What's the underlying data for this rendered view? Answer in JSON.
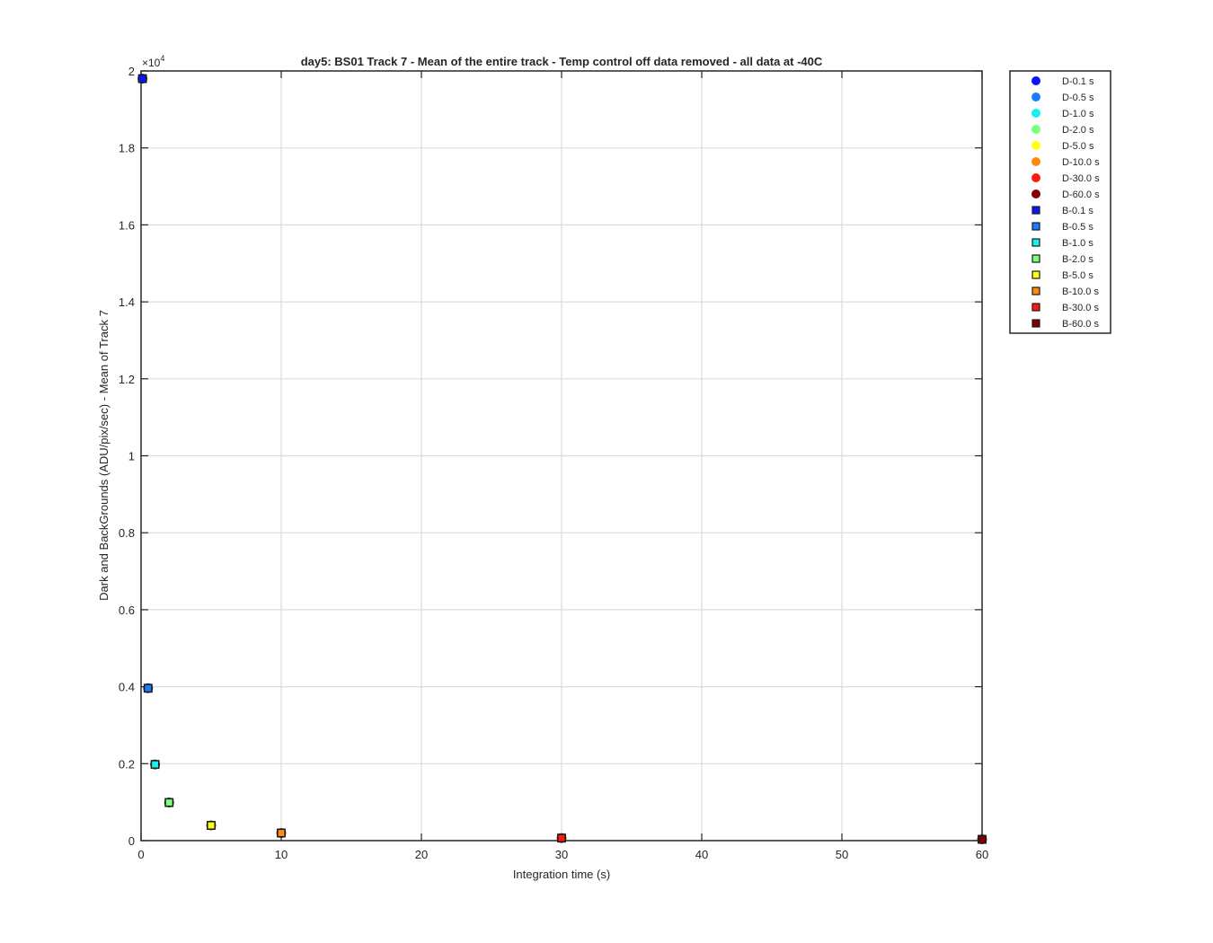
{
  "chart_data": {
    "type": "scatter",
    "title": "day5: BS01  Track 7 - Mean of the entire track - Temp control off data removed - all data at -40C",
    "xlabel": "Integration time (s)",
    "ylabel": "Dark and BackGrounds (ADU/pix/sec) - Mean of Track 7",
    "xlim": [
      0,
      60
    ],
    "ylim": [
      0,
      2
    ],
    "y_exponent_label": "×10",
    "y_exponent_power": "4",
    "x_ticks": [
      0,
      10,
      20,
      30,
      40,
      50,
      60
    ],
    "x_tick_labels": [
      "0",
      "10",
      "20",
      "30",
      "40",
      "50",
      "60"
    ],
    "y_ticks": [
      0,
      0.2,
      0.4,
      0.6,
      0.8,
      1,
      1.2,
      1.4,
      1.6,
      1.8,
      2
    ],
    "y_tick_labels": [
      "0",
      "0.2",
      "0.4",
      "0.6",
      "0.8",
      "1",
      "1.2",
      "1.4",
      "1.6",
      "1.8",
      "2"
    ],
    "grid": true,
    "legend_position": "outside-top-right",
    "series": [
      {
        "name": "D-0.1 s",
        "marker": "circle",
        "color": "#0a14ff",
        "x": [
          0.1
        ],
        "y": [
          1.98
        ]
      },
      {
        "name": "D-0.5 s",
        "marker": "circle",
        "color": "#1a7cff",
        "x": [
          0.5
        ],
        "y": [
          0.396
        ]
      },
      {
        "name": "D-1.0 s",
        "marker": "circle",
        "color": "#17f0ee",
        "x": [
          1.0
        ],
        "y": [
          0.198
        ]
      },
      {
        "name": "D-2.0 s",
        "marker": "circle",
        "color": "#7cff7a",
        "x": [
          2.0
        ],
        "y": [
          0.099
        ]
      },
      {
        "name": "D-5.0 s",
        "marker": "circle",
        "color": "#ffff10",
        "x": [
          5.0
        ],
        "y": [
          0.0396
        ]
      },
      {
        "name": "D-10.0 s",
        "marker": "circle",
        "color": "#ff8a10",
        "x": [
          10.0
        ],
        "y": [
          0.0198
        ]
      },
      {
        "name": "D-30.0 s",
        "marker": "circle",
        "color": "#ff1a10",
        "x": [
          30.0
        ],
        "y": [
          0.0066
        ]
      },
      {
        "name": "D-60.0 s",
        "marker": "circle",
        "color": "#800000",
        "x": [
          60.0
        ],
        "y": [
          0.0033
        ]
      },
      {
        "name": "B-0.1 s",
        "marker": "square",
        "color": "#0a14ff",
        "x": [
          0.1
        ],
        "y": [
          1.98
        ]
      },
      {
        "name": "B-0.5 s",
        "marker": "square",
        "color": "#1a7cff",
        "x": [
          0.5
        ],
        "y": [
          0.396
        ]
      },
      {
        "name": "B-1.0 s",
        "marker": "square",
        "color": "#17f0ee",
        "x": [
          1.0
        ],
        "y": [
          0.198
        ]
      },
      {
        "name": "B-2.0 s",
        "marker": "square",
        "color": "#7cff7a",
        "x": [
          2.0
        ],
        "y": [
          0.099
        ]
      },
      {
        "name": "B-5.0 s",
        "marker": "square",
        "color": "#ffff10",
        "x": [
          5.0
        ],
        "y": [
          0.0396
        ]
      },
      {
        "name": "B-10.0 s",
        "marker": "square",
        "color": "#ff8a10",
        "x": [
          10.0
        ],
        "y": [
          0.0198
        ]
      },
      {
        "name": "B-30.0 s",
        "marker": "square",
        "color": "#ff1a10",
        "x": [
          30.0
        ],
        "y": [
          0.0066
        ]
      },
      {
        "name": "B-60.0 s",
        "marker": "square",
        "color": "#800000",
        "x": [
          60.0
        ],
        "y": [
          0.0033
        ]
      }
    ]
  }
}
